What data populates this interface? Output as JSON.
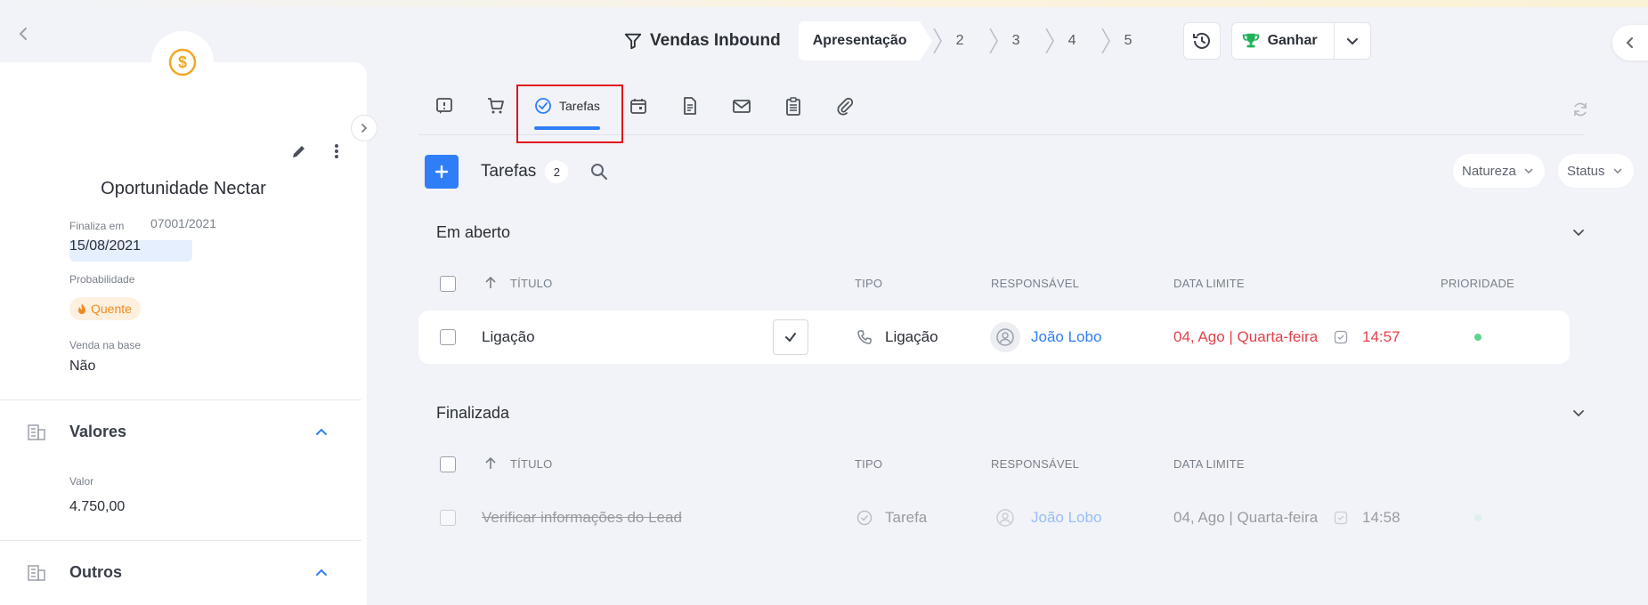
{
  "header": {
    "pipeline_name": "Vendas Inbound",
    "stage_active": "Apresentação",
    "stages": [
      "2",
      "3",
      "4",
      "5"
    ],
    "win_label": "Ganhar"
  },
  "left_panel": {
    "title": "Oportunidade Nectar",
    "code": "07001/2021",
    "fields": {
      "finaliza_label": "Finaliza em",
      "finaliza_value": "15/08/2021",
      "probabilidade_label": "Probabilidade",
      "probabilidade_value": "Quente",
      "venda_label": "Venda na base",
      "venda_value": "Não"
    },
    "sections": {
      "valores_title": "Valores",
      "valor_label": "Valor",
      "valor_value": "4.750,00",
      "outros_title": "Outros"
    }
  },
  "tabs": {
    "active_label": "Tarefas"
  },
  "toolbar": {
    "title": "Tarefas",
    "count": "2",
    "filter_natureza": "Natureza",
    "filter_status": "Status"
  },
  "columns": {
    "titulo": "TÍTULO",
    "tipo": "TIPO",
    "responsavel": "RESPONSÁVEL",
    "data_limite": "DATA LIMITE",
    "prioridade": "PRIORIDADE"
  },
  "groups": {
    "open": {
      "title": "Em aberto",
      "rows": [
        {
          "title": "Ligação",
          "type": "Ligação",
          "responsible": "João Lobo",
          "due_date": "04, Ago | Quarta-feira",
          "due_time": "14:57"
        }
      ]
    },
    "done": {
      "title": "Finalizada",
      "rows": [
        {
          "title": "Verificar informações do Lead",
          "type": "Tarefa",
          "responsible": "João Lobo",
          "due_date": "04, Ago | Quarta-feira",
          "due_time": "14:58"
        }
      ]
    }
  },
  "colors": {
    "accent": "#2f7ef7",
    "overdue": "#e5404a",
    "hot": "#ef8a1f",
    "priority_low": "#5fd38d",
    "highlight": "#e0131f"
  }
}
